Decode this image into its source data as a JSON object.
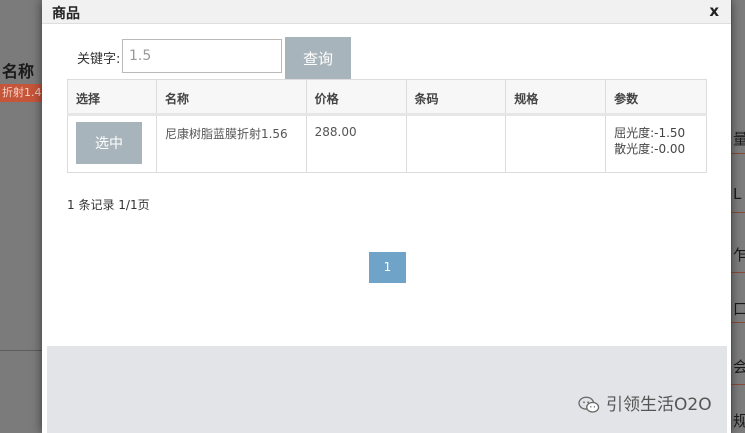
{
  "background": {
    "left_title": "名称",
    "left_sub": "折射1.4",
    "right_chars": [
      "量",
      "L",
      "乍",
      "口",
      "会",
      "规"
    ]
  },
  "modal": {
    "title": "商品",
    "close_label": "x"
  },
  "search": {
    "label": "关键字:",
    "value": "1.5",
    "button_label": "查询"
  },
  "table": {
    "headers": [
      "选择",
      "名称",
      "价格",
      "条码",
      "规格",
      "参数"
    ],
    "rows": [
      {
        "select_label": "选中",
        "name": "尼康树脂蓝膜折射1.56",
        "price": "288.00",
        "barcode": "",
        "spec": "",
        "params": [
          "屈光度:-1.50",
          "散光度:-0.00"
        ]
      }
    ]
  },
  "pagination": {
    "record_info": "1 条记录 1/1页",
    "current_page": "1"
  },
  "watermark": {
    "text": "引领生活O2O"
  },
  "colors": {
    "button_gray": "#a8b4bb",
    "page_active": "#6fa3c8",
    "footer": "#e3e4e7",
    "overlay": "#7b7b7b",
    "accent_red": "#c7553a"
  }
}
